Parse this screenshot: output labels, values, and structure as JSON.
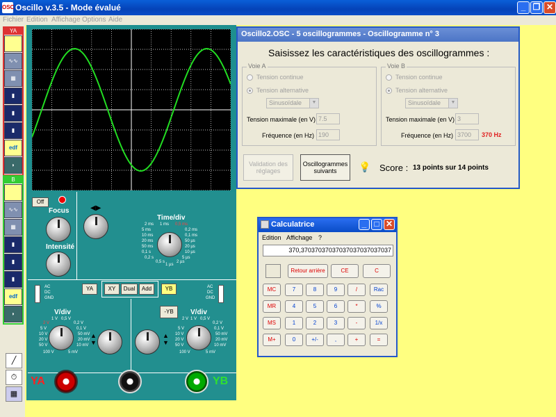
{
  "window": {
    "title": "Oscillo v.3.5 - Mode évalué",
    "app_icon": "OSC"
  },
  "menu": [
    "Fichier",
    "Edition",
    "Affichage",
    "Options",
    "Aide"
  ],
  "toolbar": {
    "ya_label": "YA",
    "yb_label": "B"
  },
  "scope": {
    "off_label": "Off",
    "focus": "Focus",
    "intensite": "Intensité",
    "timediv": "Time/div",
    "timediv_scale_left": [
      "2 ms",
      "1 ms",
      "5 ms",
      "10 ms",
      "20 ms",
      "50 ms",
      "0,1 s",
      "0,2 s",
      "0,5 s"
    ],
    "timediv_scale_right": [
      "0,5 ms",
      "0,2 ms",
      "0,1 ms",
      "50 µs",
      "20 µs",
      "10 µs",
      "5 µs",
      "2 µs",
      "1 µs"
    ],
    "vdiv": "V/div",
    "vdiv_scale_a_left": [
      "2 V",
      "5 V",
      "10 V",
      "20 V",
      "50 V",
      "100 V"
    ],
    "vdiv_scale_a_top": [
      "1 V",
      "0,5 V"
    ],
    "vdiv_scale_a_right": [
      "0,2 V",
      "0,1 V",
      "50 mV",
      "20 mV",
      "10 mV",
      "5 mV"
    ],
    "vdiv_scale_b_top": [
      "2 V",
      "1 V",
      "0,5 V"
    ],
    "vdiv_scale_b_left": [
      "5 V",
      "10 V",
      "20 V",
      "50 V",
      "100 V"
    ],
    "vdiv_scale_b_right": [
      "0,2 V",
      "0,1 V",
      "50 mV",
      "20 mV",
      "10 mV",
      "5 mV"
    ],
    "coupling": [
      "AC",
      "DC",
      "GND"
    ],
    "btn_ya": "YA",
    "btn_xy": "XY",
    "btn_dual": "Dual",
    "btn_add": "Add",
    "btn_yb": "YB",
    "btn_minus_yb": "-YB",
    "jack_ya": "YA",
    "jack_yb": "YB",
    "colors": {
      "trace": "#22dd22",
      "grid": "#ffffff",
      "panel": "#228f8f"
    }
  },
  "dialog": {
    "title": "Oscillo2.OSC - 5 oscillogrammes - Oscillogramme n° 3",
    "prompt": "Saisissez les caractéristiques des oscillogrammes :",
    "voie_a": {
      "label": "Voie A",
      "tension_continue": "Tension continue",
      "tension_alternative": "Tension alternative",
      "waveform": "Sinusoïdale",
      "tension_max_label": "Tension maximale (en V) :",
      "tension_max_value": "7.5",
      "frequence_label": "Fréquence (en Hz) :",
      "frequence_value": "190"
    },
    "voie_b": {
      "label": "Voie B",
      "tension_continue": "Tension continue",
      "tension_alternative": "Tension alternative",
      "waveform": "Sinusoïdale",
      "tension_max_label": "Tension maximale (en V) :",
      "tension_max_value": "3",
      "frequence_label": "Fréquence (en Hz) :",
      "frequence_value": "3700",
      "correction": "370 Hz"
    },
    "btn_validation": "Validation des réglages",
    "btn_suivants": "Oscillogrammes suivants",
    "score_label": "Score :",
    "score_value": "13 points sur 14 points"
  },
  "calc": {
    "title": "Calculatrice",
    "menu": [
      "Edition",
      "Affichage",
      "?"
    ],
    "display": "370,37037037037037037037037037",
    "btn_back": "Retour arrière",
    "btn_ce": "CE",
    "btn_c": "C",
    "rows": [
      [
        "MC",
        "7",
        "8",
        "9",
        "/",
        "Rac"
      ],
      [
        "MR",
        "4",
        "5",
        "6",
        "*",
        "%"
      ],
      [
        "MS",
        "1",
        "2",
        "3",
        "-",
        "1/x"
      ],
      [
        "M+",
        "0",
        "+/-",
        ",",
        "+",
        "="
      ]
    ]
  }
}
